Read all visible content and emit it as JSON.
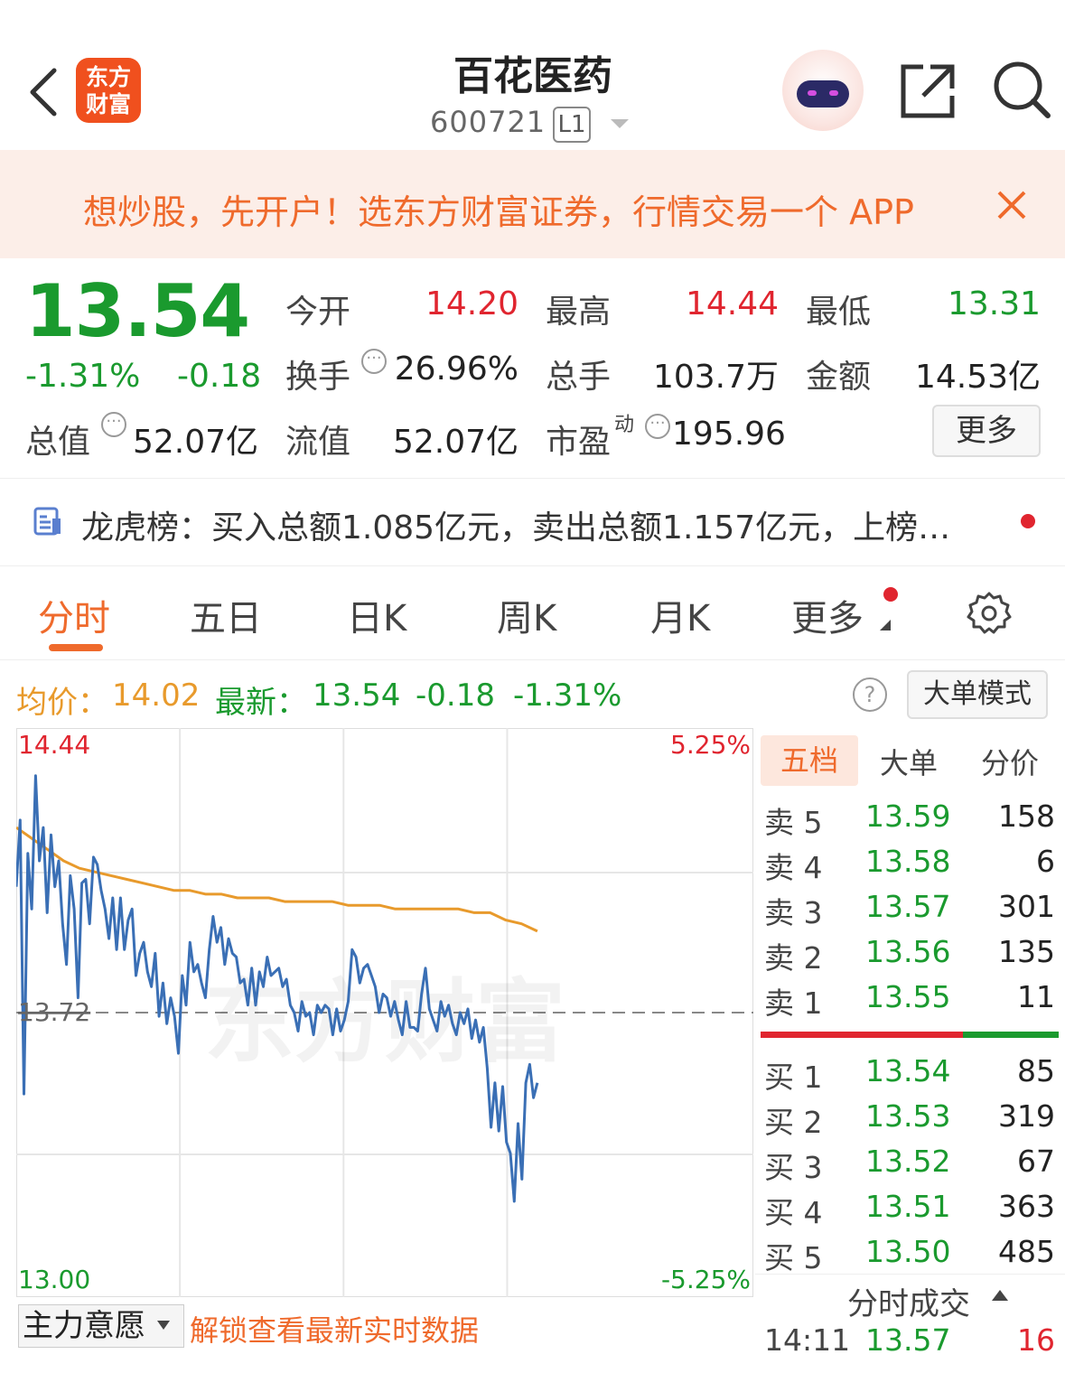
{
  "header": {
    "logo_line1": "东方",
    "logo_line2": "财富",
    "stock_name": "百花医药",
    "stock_code": "600721",
    "level": "L1"
  },
  "banner": {
    "text": "想炒股，先开户！选东方财富证券，行情交易一个 APP"
  },
  "quote": {
    "price": "13.54",
    "change_pct": "-1.31%",
    "change_abs": "-0.18",
    "open_label": "今开",
    "open_value": "14.20",
    "high_label": "最高",
    "high_value": "14.44",
    "low_label": "最低",
    "low_value": "13.31",
    "turnover_label": "换手",
    "turnover_value": "26.96%",
    "volume_label": "总手",
    "volume_value": "103.7万",
    "amount_label": "金额",
    "amount_value": "14.53亿",
    "mktcap_label": "总值",
    "mktcap_value": "52.07亿",
    "float_label": "流值",
    "float_value": "52.07亿",
    "pe_label": "市盈",
    "pe_super": "动",
    "pe_value": "195.96",
    "more_label": "更多"
  },
  "news": {
    "text": "龙虎榜：买入总额1.085亿元，卖出总额1.157亿元，上榜…"
  },
  "tabs": [
    "分时",
    "五日",
    "日K",
    "周K",
    "月K",
    "更多"
  ],
  "strip": {
    "avg_label": "均价：",
    "avg_value": "14.02",
    "latest_label": "最新：",
    "latest_value": "13.54",
    "latest_chg": "-0.18",
    "latest_pct": "-1.31%",
    "help": "?",
    "big_order_label": "大单模式"
  },
  "chart_data": {
    "type": "line",
    "y_left_ticks": [
      "14.44",
      "13.72",
      "13.00"
    ],
    "y_right_ticks": [
      "5.25%",
      "-5.25%"
    ],
    "ylim": [
      13.0,
      14.44
    ],
    "prev_close": 13.72,
    "watermark": "东方财富",
    "series": [
      {
        "name": "",
        "color": "#3a6fb5",
        "values": [
          14.06,
          14.24,
          13.5,
          14.15,
          14.0,
          14.36,
          14.13,
          14.22,
          13.99,
          14.2,
          14.06,
          14.13,
          13.96,
          13.85,
          14.09,
          14.0,
          13.76,
          14.07,
          14.08,
          13.96,
          14.14,
          14.12,
          14.05,
          14.0,
          13.92,
          14.03,
          13.89,
          14.03,
          13.89,
          13.97,
          14.0,
          13.82,
          13.88,
          13.91,
          13.83,
          13.79,
          13.88,
          13.71,
          13.8,
          13.69,
          13.76,
          13.71,
          13.61,
          13.82,
          13.74,
          13.91,
          13.83,
          13.85,
          13.8,
          13.76,
          13.89,
          13.98,
          13.91,
          13.95,
          13.85,
          13.92,
          13.88,
          13.87,
          13.8,
          13.81,
          13.74,
          13.84,
          13.74,
          13.83,
          13.79,
          13.87,
          13.82,
          13.83,
          13.84,
          13.79,
          13.81,
          13.74,
          13.72,
          13.67,
          13.75,
          13.71,
          13.72,
          13.66,
          13.74,
          13.72,
          13.74,
          13.73,
          13.66,
          13.73,
          13.67,
          13.7,
          13.75,
          13.89,
          13.87,
          13.8,
          13.84,
          13.85,
          13.82,
          13.79,
          13.72,
          13.77,
          13.76,
          13.71,
          13.75,
          13.7,
          13.66,
          13.75,
          13.68,
          13.68,
          13.67,
          13.77,
          13.84,
          13.73,
          13.7,
          13.67,
          13.75,
          13.71,
          13.74,
          13.69,
          13.66,
          13.72,
          13.69,
          13.73,
          13.65,
          13.7,
          13.64,
          13.68,
          13.57,
          13.41,
          13.53,
          13.4,
          13.52,
          13.37,
          13.34,
          13.21,
          13.42,
          13.27,
          13.53,
          13.58,
          13.49,
          13.53
        ],
        "x_end_fraction": 0.707
      },
      {
        "name": "",
        "color": "#e89a2c",
        "values": [
          14.22,
          14.19,
          14.16,
          14.13,
          14.11,
          14.1,
          14.09,
          14.08,
          14.07,
          14.06,
          14.05,
          14.05,
          14.04,
          14.04,
          14.03,
          14.03,
          14.03,
          14.02,
          14.02,
          14.02,
          14.02,
          14.01,
          14.01,
          14.01,
          14.0,
          14.0,
          14.0,
          14.0,
          14.0,
          13.99,
          13.99,
          13.97,
          13.96,
          13.94
        ],
        "x_end_fraction": 0.707
      }
    ]
  },
  "order_book": {
    "tabs": [
      "五档",
      "大单",
      "分价"
    ],
    "asks": [
      {
        "label": "卖 5",
        "price": "13.59",
        "vol": "158"
      },
      {
        "label": "卖 4",
        "price": "13.58",
        "vol": "6"
      },
      {
        "label": "卖 3",
        "price": "13.57",
        "vol": "301"
      },
      {
        "label": "卖 2",
        "price": "13.56",
        "vol": "135"
      },
      {
        "label": "卖 1",
        "price": "13.55",
        "vol": "11"
      }
    ],
    "bids": [
      {
        "label": "买 1",
        "price": "13.54",
        "vol": "85"
      },
      {
        "label": "买 2",
        "price": "13.53",
        "vol": "319"
      },
      {
        "label": "买 3",
        "price": "13.52",
        "vol": "67"
      },
      {
        "label": "买 4",
        "price": "13.51",
        "vol": "363"
      },
      {
        "label": "买 5",
        "price": "13.50",
        "vol": "485"
      }
    ],
    "ticks_title": "分时成交",
    "tick": {
      "time": "14:11",
      "price": "13.57",
      "vol": "16"
    }
  },
  "bottom": {
    "force_label": "主力意愿",
    "unlock_text": "解锁查看最新实时数据"
  },
  "colors": {
    "accent": "#ef6a2c",
    "up": "#e0252f",
    "down": "#1a9a2e",
    "price_line": "#3a6fb5",
    "avg_line": "#e89a2c"
  }
}
